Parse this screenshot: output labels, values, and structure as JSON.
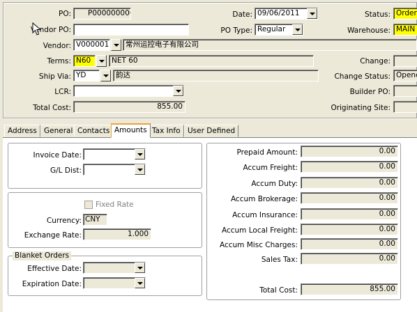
{
  "header": {
    "po": {
      "label": "PO:",
      "value": "P000000006"
    },
    "vendor_po": {
      "label": "Vendor PO:",
      "value": ""
    },
    "vendor": {
      "label": "Vendor:",
      "code": "V000001",
      "name": "常州运控电子有限公司"
    },
    "terms": {
      "label": "Terms:",
      "code": "N60",
      "desc": "NET 60"
    },
    "ship_via": {
      "label": "Ship Via:",
      "code": "YD",
      "desc": "韵达"
    },
    "lcr": {
      "label": "LCR:",
      "value": ""
    },
    "total_cost": {
      "label": "Total Cost:",
      "value": "855.00"
    },
    "date": {
      "label": "Date:",
      "value": "09/06/2011"
    },
    "po_type": {
      "label": "PO Type:",
      "value": "Regular"
    },
    "status": {
      "label": "Status:",
      "value": "Ordere"
    },
    "warehouse": {
      "label": "Warehouse:",
      "value": "MAIN"
    },
    "change": {
      "label": "Change:",
      "value": ""
    },
    "change_status": {
      "label": "Change Status:",
      "value": "Opene"
    },
    "builder_po": {
      "label": "Builder PO:",
      "value": ""
    },
    "originating_site": {
      "label": "Originating Site:",
      "value": ""
    }
  },
  "tabs": [
    {
      "label": "Address",
      "active": false
    },
    {
      "label": "General",
      "active": false
    },
    {
      "label": "Contacts",
      "active": false
    },
    {
      "label": "Amounts",
      "active": true
    },
    {
      "label": "Tax Info",
      "active": false
    },
    {
      "label": "User Defined",
      "active": false
    }
  ],
  "amounts": {
    "invoice_date": {
      "label": "Invoice Date:",
      "value": ""
    },
    "gl_dist": {
      "label": "G/L Dist:",
      "value": ""
    },
    "fixed_rate": {
      "label": "Fixed Rate",
      "checked": false
    },
    "currency": {
      "label": "Currency:",
      "value": "CNY"
    },
    "exchange_rate": {
      "label": "Exchange Rate:",
      "value": "1.000"
    },
    "blanket_orders": {
      "title": "Blanket Orders",
      "effective_date": {
        "label": "Effective Date:",
        "value": ""
      },
      "expiration_date": {
        "label": "Expiration Date:",
        "value": ""
      }
    },
    "right": [
      {
        "label": "Prepaid Amount:",
        "value": "0.00"
      },
      {
        "label": "Accum Freight:",
        "value": "0.00"
      },
      {
        "label": "Accum Duty:",
        "value": "0.00"
      },
      {
        "label": "Accum Brokerage:",
        "value": "0.00"
      },
      {
        "label": "Accum Insurance:",
        "value": "0.00"
      },
      {
        "label": "Accum Local Freight:",
        "value": "0.00"
      },
      {
        "label": "Accum Misc Charges:",
        "value": "0.00"
      },
      {
        "label": "Sales Tax:",
        "value": "0.00"
      }
    ],
    "total_cost": {
      "label": "Total Cost:",
      "value": "855.00"
    }
  },
  "colors": {
    "highlight": "#ffff00",
    "tab_accent": "#e6a33e",
    "window_bg": "#ece9d8"
  }
}
